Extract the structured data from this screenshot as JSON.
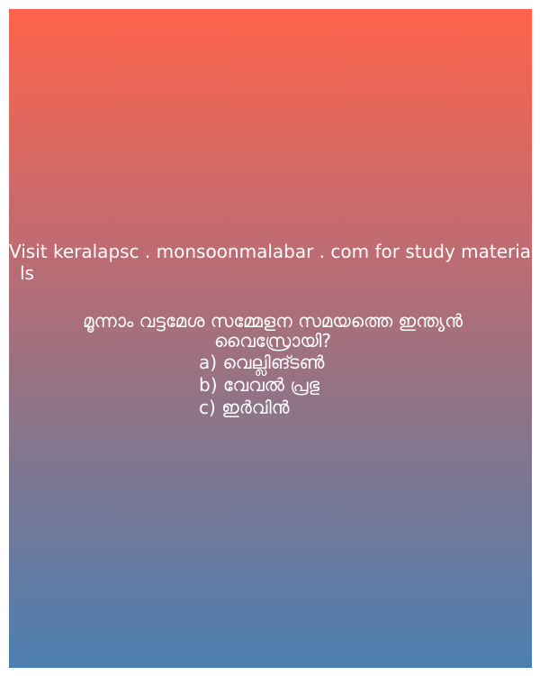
{
  "promo": {
    "line1": "Visit keralapsc . monsoonmalabar . com for study materia",
    "line2": "ls"
  },
  "question": {
    "text": "മൂന്നാം വട്ടമേശ സമ്മേളന സമയത്തെ ഇന്ത്യൻ വൈസ്രോയി?"
  },
  "options": [
    {
      "label": "a) വെല്ലിങ്ടൺ"
    },
    {
      "label": "b) വേവൽ പ്രഭു"
    },
    {
      "label": "c) ഇർവിൻ"
    }
  ],
  "colors": {
    "gradient_top": "#fe634b",
    "gradient_bottom": "#4c7fb1",
    "text": "#ffffff"
  }
}
